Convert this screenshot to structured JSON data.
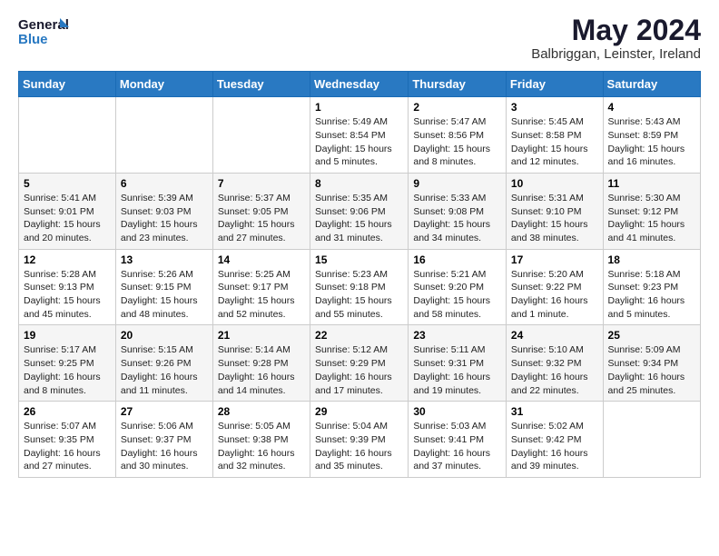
{
  "header": {
    "logo_line1": "General",
    "logo_line2": "Blue",
    "month_title": "May 2024",
    "subtitle": "Balbriggan, Leinster, Ireland"
  },
  "days_of_week": [
    "Sunday",
    "Monday",
    "Tuesday",
    "Wednesday",
    "Thursday",
    "Friday",
    "Saturday"
  ],
  "weeks": [
    [
      {
        "day": "",
        "info": ""
      },
      {
        "day": "",
        "info": ""
      },
      {
        "day": "",
        "info": ""
      },
      {
        "day": "1",
        "info": "Sunrise: 5:49 AM\nSunset: 8:54 PM\nDaylight: 15 hours\nand 5 minutes."
      },
      {
        "day": "2",
        "info": "Sunrise: 5:47 AM\nSunset: 8:56 PM\nDaylight: 15 hours\nand 8 minutes."
      },
      {
        "day": "3",
        "info": "Sunrise: 5:45 AM\nSunset: 8:58 PM\nDaylight: 15 hours\nand 12 minutes."
      },
      {
        "day": "4",
        "info": "Sunrise: 5:43 AM\nSunset: 8:59 PM\nDaylight: 15 hours\nand 16 minutes."
      }
    ],
    [
      {
        "day": "5",
        "info": "Sunrise: 5:41 AM\nSunset: 9:01 PM\nDaylight: 15 hours\nand 20 minutes."
      },
      {
        "day": "6",
        "info": "Sunrise: 5:39 AM\nSunset: 9:03 PM\nDaylight: 15 hours\nand 23 minutes."
      },
      {
        "day": "7",
        "info": "Sunrise: 5:37 AM\nSunset: 9:05 PM\nDaylight: 15 hours\nand 27 minutes."
      },
      {
        "day": "8",
        "info": "Sunrise: 5:35 AM\nSunset: 9:06 PM\nDaylight: 15 hours\nand 31 minutes."
      },
      {
        "day": "9",
        "info": "Sunrise: 5:33 AM\nSunset: 9:08 PM\nDaylight: 15 hours\nand 34 minutes."
      },
      {
        "day": "10",
        "info": "Sunrise: 5:31 AM\nSunset: 9:10 PM\nDaylight: 15 hours\nand 38 minutes."
      },
      {
        "day": "11",
        "info": "Sunrise: 5:30 AM\nSunset: 9:12 PM\nDaylight: 15 hours\nand 41 minutes."
      }
    ],
    [
      {
        "day": "12",
        "info": "Sunrise: 5:28 AM\nSunset: 9:13 PM\nDaylight: 15 hours\nand 45 minutes."
      },
      {
        "day": "13",
        "info": "Sunrise: 5:26 AM\nSunset: 9:15 PM\nDaylight: 15 hours\nand 48 minutes."
      },
      {
        "day": "14",
        "info": "Sunrise: 5:25 AM\nSunset: 9:17 PM\nDaylight: 15 hours\nand 52 minutes."
      },
      {
        "day": "15",
        "info": "Sunrise: 5:23 AM\nSunset: 9:18 PM\nDaylight: 15 hours\nand 55 minutes."
      },
      {
        "day": "16",
        "info": "Sunrise: 5:21 AM\nSunset: 9:20 PM\nDaylight: 15 hours\nand 58 minutes."
      },
      {
        "day": "17",
        "info": "Sunrise: 5:20 AM\nSunset: 9:22 PM\nDaylight: 16 hours\nand 1 minute."
      },
      {
        "day": "18",
        "info": "Sunrise: 5:18 AM\nSunset: 9:23 PM\nDaylight: 16 hours\nand 5 minutes."
      }
    ],
    [
      {
        "day": "19",
        "info": "Sunrise: 5:17 AM\nSunset: 9:25 PM\nDaylight: 16 hours\nand 8 minutes."
      },
      {
        "day": "20",
        "info": "Sunrise: 5:15 AM\nSunset: 9:26 PM\nDaylight: 16 hours\nand 11 minutes."
      },
      {
        "day": "21",
        "info": "Sunrise: 5:14 AM\nSunset: 9:28 PM\nDaylight: 16 hours\nand 14 minutes."
      },
      {
        "day": "22",
        "info": "Sunrise: 5:12 AM\nSunset: 9:29 PM\nDaylight: 16 hours\nand 17 minutes."
      },
      {
        "day": "23",
        "info": "Sunrise: 5:11 AM\nSunset: 9:31 PM\nDaylight: 16 hours\nand 19 minutes."
      },
      {
        "day": "24",
        "info": "Sunrise: 5:10 AM\nSunset: 9:32 PM\nDaylight: 16 hours\nand 22 minutes."
      },
      {
        "day": "25",
        "info": "Sunrise: 5:09 AM\nSunset: 9:34 PM\nDaylight: 16 hours\nand 25 minutes."
      }
    ],
    [
      {
        "day": "26",
        "info": "Sunrise: 5:07 AM\nSunset: 9:35 PM\nDaylight: 16 hours\nand 27 minutes."
      },
      {
        "day": "27",
        "info": "Sunrise: 5:06 AM\nSunset: 9:37 PM\nDaylight: 16 hours\nand 30 minutes."
      },
      {
        "day": "28",
        "info": "Sunrise: 5:05 AM\nSunset: 9:38 PM\nDaylight: 16 hours\nand 32 minutes."
      },
      {
        "day": "29",
        "info": "Sunrise: 5:04 AM\nSunset: 9:39 PM\nDaylight: 16 hours\nand 35 minutes."
      },
      {
        "day": "30",
        "info": "Sunrise: 5:03 AM\nSunset: 9:41 PM\nDaylight: 16 hours\nand 37 minutes."
      },
      {
        "day": "31",
        "info": "Sunrise: 5:02 AM\nSunset: 9:42 PM\nDaylight: 16 hours\nand 39 minutes."
      },
      {
        "day": "",
        "info": ""
      }
    ]
  ]
}
